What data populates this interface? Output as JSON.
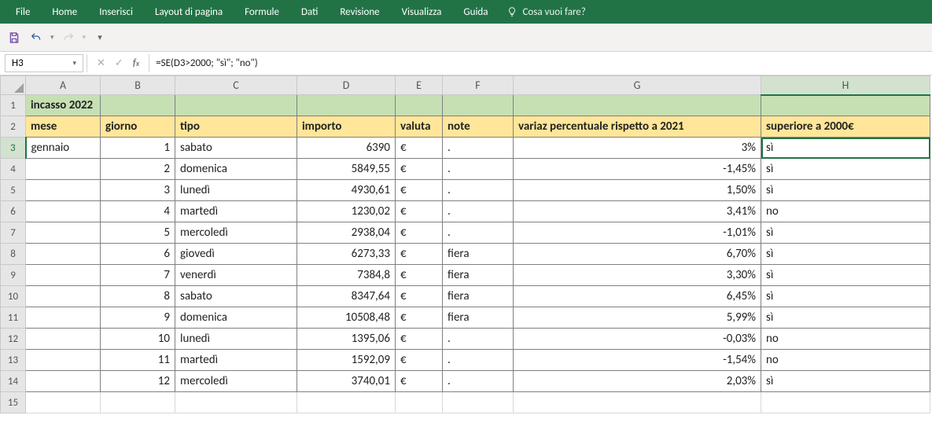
{
  "ribbon": {
    "tabs": [
      "File",
      "Home",
      "Inserisci",
      "Layout di pagina",
      "Formule",
      "Dati",
      "Revisione",
      "Visualizza",
      "Guida"
    ],
    "tell_me": "Cosa vuoi fare?"
  },
  "name_box": "H3",
  "formula": "=SE(D3>2000; \"sì\"; \"no\")",
  "columns": [
    "A",
    "B",
    "C",
    "D",
    "E",
    "F",
    "G",
    "H"
  ],
  "selected_col_index": 7,
  "selected_row": 3,
  "row1_title": "incasso 2022",
  "headers": {
    "A": "mese",
    "B": "giorno",
    "C": "tipo",
    "D": "importo",
    "E": "valuta",
    "F": "note",
    "G": "variaz percentuale rispetto a 2021",
    "H": "superiore a 2000€"
  },
  "rows": [
    {
      "n": 3,
      "A": "gennaio",
      "B": "1",
      "C": "sabato",
      "D": "6390",
      "E": "€",
      "F": ".",
      "G": "3%",
      "H": "sì"
    },
    {
      "n": 4,
      "A": "",
      "B": "2",
      "C": "domenica",
      "D": "5849,55",
      "E": "€",
      "F": ".",
      "G": "-1,45%",
      "H": "sì"
    },
    {
      "n": 5,
      "A": "",
      "B": "3",
      "C": "lunedì",
      "D": "4930,61",
      "E": "€",
      "F": ".",
      "G": "1,50%",
      "H": "sì"
    },
    {
      "n": 6,
      "A": "",
      "B": "4",
      "C": "martedì",
      "D": "1230,02",
      "E": "€",
      "F": ".",
      "G": "3,41%",
      "H": "no"
    },
    {
      "n": 7,
      "A": "",
      "B": "5",
      "C": "mercoledì",
      "D": "2938,04",
      "E": "€",
      "F": ".",
      "G": "-1,01%",
      "H": "sì"
    },
    {
      "n": 8,
      "A": "",
      "B": "6",
      "C": "giovedì",
      "D": "6273,33",
      "E": "€",
      "F": "fiera",
      "G": "6,70%",
      "H": "sì"
    },
    {
      "n": 9,
      "A": "",
      "B": "7",
      "C": "venerdì",
      "D": "7384,8",
      "E": "€",
      "F": "fiera",
      "G": "3,30%",
      "H": "sì"
    },
    {
      "n": 10,
      "A": "",
      "B": "8",
      "C": "sabato",
      "D": "8347,64",
      "E": "€",
      "F": "fiera",
      "G": "6,45%",
      "H": "sì"
    },
    {
      "n": 11,
      "A": "",
      "B": "9",
      "C": "domenica",
      "D": "10508,48",
      "E": "€",
      "F": "fiera",
      "G": "5,99%",
      "H": "sì"
    },
    {
      "n": 12,
      "A": "",
      "B": "10",
      "C": "lunedì",
      "D": "1395,06",
      "E": "€",
      "F": ".",
      "G": "-0,03%",
      "H": "no"
    },
    {
      "n": 13,
      "A": "",
      "B": "11",
      "C": "martedì",
      "D": "1592,09",
      "E": "€",
      "F": ".",
      "G": "-1,54%",
      "H": "no"
    },
    {
      "n": 14,
      "A": "",
      "B": "12",
      "C": "mercoledì",
      "D": "3740,01",
      "E": "€",
      "F": ".",
      "G": "2,03%",
      "H": "sì"
    }
  ],
  "last_visible_row": 15
}
